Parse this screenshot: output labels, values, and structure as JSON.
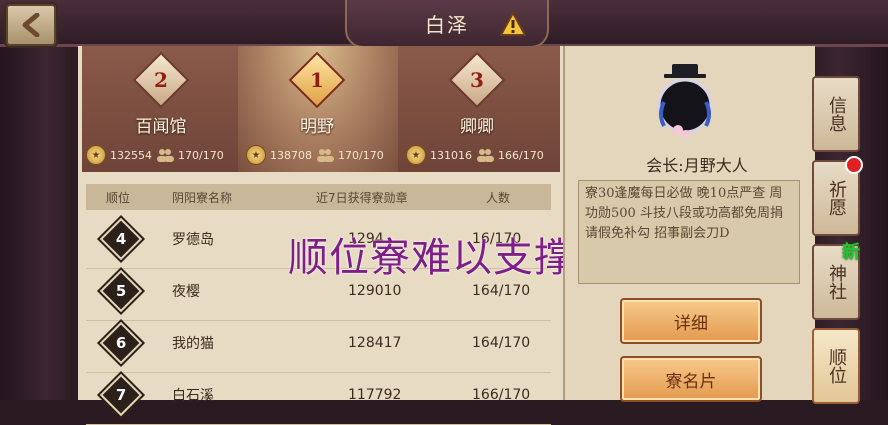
{
  "header": {
    "title": "白泽",
    "back_label": "",
    "alert_icon": "exclamation-icon"
  },
  "podium": [
    {
      "rank": "2",
      "name": "百闻馆",
      "score": "132554",
      "members": "170/170"
    },
    {
      "rank": "1",
      "name": "明野",
      "score": "138708",
      "members": "170/170"
    },
    {
      "rank": "3",
      "name": "卿卿",
      "score": "131016",
      "members": "166/170"
    }
  ],
  "table": {
    "headers": [
      "顺位",
      "阴阳寮名称",
      "近7日获得寮勋章",
      "人数"
    ],
    "rows": [
      {
        "rank": "4",
        "name": "罗德岛",
        "score": "1294",
        "members": "16/170"
      },
      {
        "rank": "5",
        "name": "夜樱",
        "score": "129010",
        "members": "164/170"
      },
      {
        "rank": "6",
        "name": "我的猫",
        "score": "128417",
        "members": "164/170"
      },
      {
        "rank": "7",
        "name": "白石溪",
        "score": "117792",
        "members": "166/170"
      }
    ]
  },
  "overlay": "顺位寮难以支撑",
  "info": {
    "leader": "会长:月野大人",
    "notice": "寮30逢魔每日必做 晚10点严查 周功勋500 斗技八段或功高都免周捐 请假免补勾 招事副会刀D",
    "buttons": {
      "detail": "详细",
      "card": "寮名片"
    }
  },
  "side_tabs": [
    {
      "label": "信息",
      "active": false
    },
    {
      "label": "祈愿",
      "active": false
    },
    {
      "label": "神社",
      "active": false
    },
    {
      "label": "顺位",
      "active": true
    }
  ],
  "new_badge": "新",
  "colors": {
    "accent": "#e39a4f",
    "overlay": "#7e1f86"
  }
}
